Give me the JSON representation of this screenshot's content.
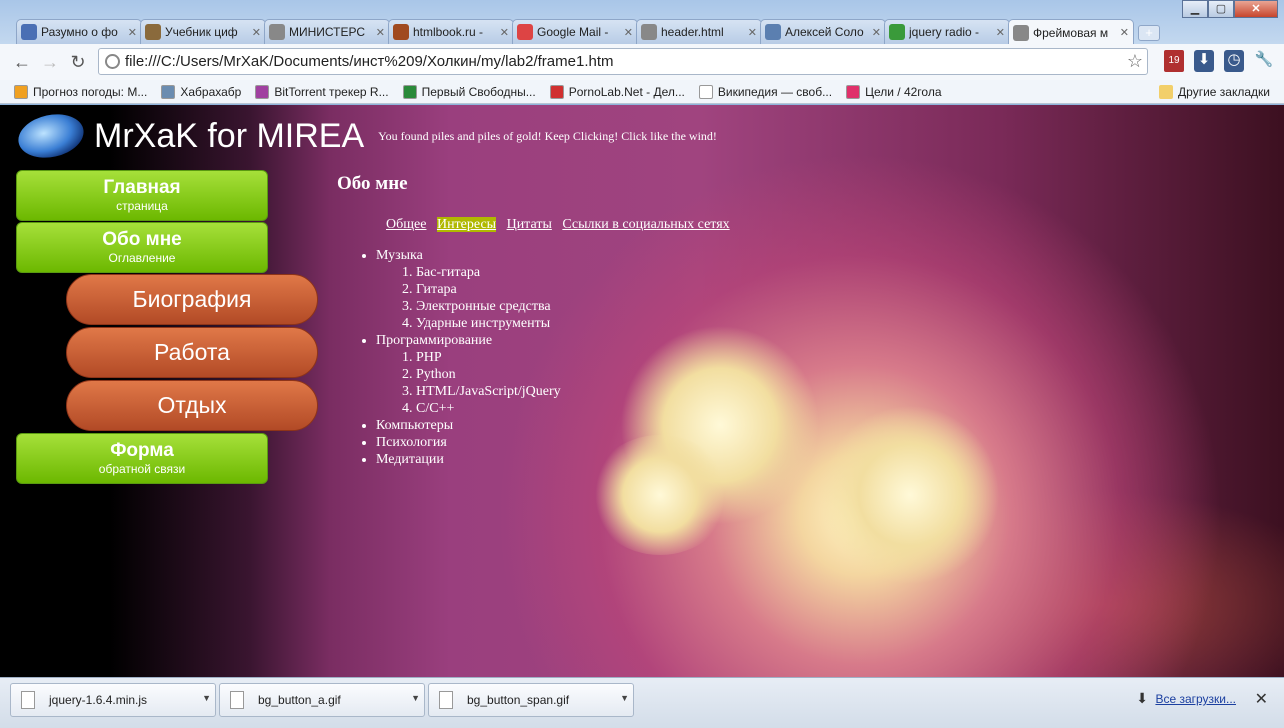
{
  "browser": {
    "tabs": [
      {
        "title": "Разумно о фо",
        "color": "#4a6fb4"
      },
      {
        "title": "Учебник циф",
        "color": "#8a6a3c"
      },
      {
        "title": "МИНИСТЕРС",
        "color": "#888888"
      },
      {
        "title": "htmlbook.ru -",
        "color": "#a04a20"
      },
      {
        "title": "Google Mail -",
        "color": "#d44"
      },
      {
        "title": "header.html",
        "color": "#888888"
      },
      {
        "title": "Алексей Соло",
        "color": "#5b7fb0"
      },
      {
        "title": "jquery radio -",
        "color": "#3a9a3a"
      },
      {
        "title": "Фреймовая м",
        "color": "#888888"
      }
    ],
    "url": "file:///C:/Users/MrXaK/Documents/инст%209/Холкин/my/lab2/frame1.htm",
    "badge": "19",
    "bookmarks": [
      {
        "label": "Прогноз погоды: М...",
        "color": "#f0a020"
      },
      {
        "label": "Хабрахабр",
        "color": "#6a8cb0"
      },
      {
        "label": "BitTorrent трекер R...",
        "color": "#a040a0"
      },
      {
        "label": "Первый Свободны...",
        "color": "#2a8a3a"
      },
      {
        "label": "PornoLab.Net - Дел...",
        "color": "#d03030"
      },
      {
        "label": "Википедия — своб...",
        "color": "#ffffff"
      },
      {
        "label": "Цели / 42гола",
        "color": "#e0306a"
      }
    ],
    "other_bookmarks": "Другие закладки"
  },
  "site": {
    "title": "MrXaK for MIREA",
    "tagline": "You found piles and piles of gold! Keep Clicking! Click like the wind!",
    "menu": {
      "home": {
        "main": "Главная",
        "sub": "страница"
      },
      "about": {
        "main": "Обо мне",
        "sub": "Оглавление"
      },
      "bio": "Биография",
      "work": "Работа",
      "rest": "Отдых",
      "form": {
        "main": "Форма",
        "sub": "обратной связи"
      }
    },
    "heading": "Обо мне",
    "subnav": [
      "Общее",
      "Интересы",
      "Цитаты",
      "Ссылки в социальных сетях"
    ],
    "interests": {
      "music": "Музыка",
      "music_items": [
        "Бас-гитара",
        "Гитара",
        "Электронные средства",
        "Ударные инструменты"
      ],
      "programming": "Программирование",
      "programming_items": [
        "PHP",
        "Python",
        "HTML/JavaScript/jQuery",
        "C/C++"
      ],
      "others": [
        "Компьютеры",
        "Психология",
        "Медитации"
      ]
    }
  },
  "downloads": {
    "items": [
      "jquery-1.6.4.min.js",
      "bg_button_a.gif",
      "bg_button_span.gif"
    ],
    "all": "Все загрузки..."
  }
}
